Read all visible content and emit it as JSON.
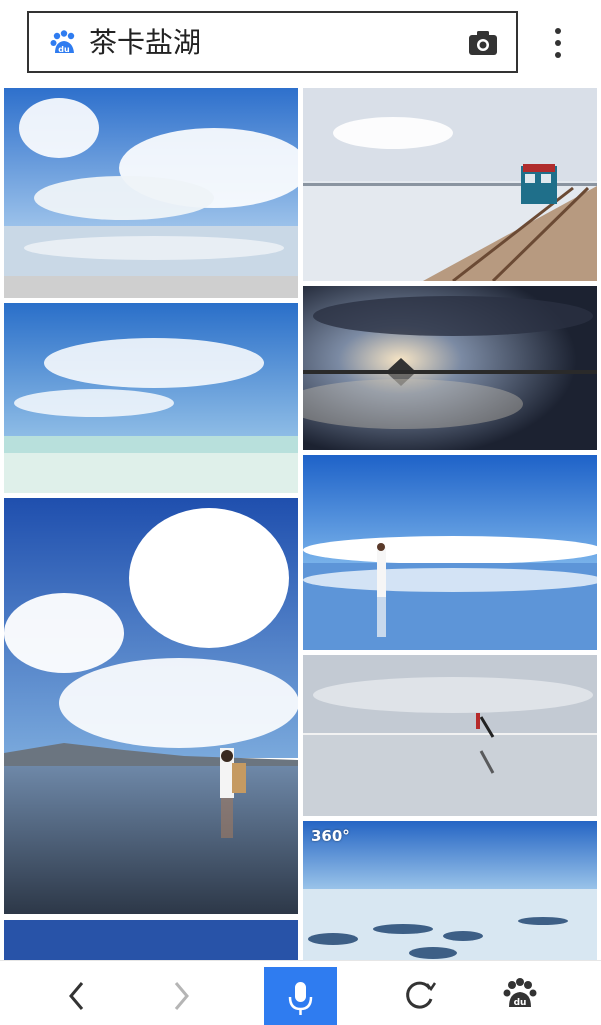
{
  "search": {
    "query": "茶卡盐湖",
    "logo_icon": "baidu-paw-icon",
    "camera_icon": "camera-icon",
    "menu_icon": "more-vertical-icon"
  },
  "results": {
    "tiles": [
      {
        "name": "result-image-1",
        "scene": "lake-clouds-reflection"
      },
      {
        "name": "result-image-2",
        "scene": "salt-lake-train"
      },
      {
        "name": "result-image-3",
        "scene": "sunset-reflection"
      },
      {
        "name": "result-image-4",
        "scene": "blue-sky-shore"
      },
      {
        "name": "result-image-5",
        "scene": "woman-white-dress"
      },
      {
        "name": "result-image-6",
        "scene": "woman-clouds-reflection"
      },
      {
        "name": "result-image-7",
        "scene": "jumping-person"
      },
      {
        "name": "result-image-8",
        "scene": "panorama-360"
      },
      {
        "name": "result-image-9",
        "scene": "partial-blue"
      }
    ],
    "badge_360": "360°"
  },
  "bottom_nav": {
    "back_icon": "back-arrow-icon",
    "forward_icon": "forward-arrow-icon",
    "voice_icon": "microphone-icon",
    "refresh_icon": "refresh-icon",
    "home_icon": "baidu-paw-icon"
  },
  "colors": {
    "accent": "#2f7cf0",
    "sky": "#2a6fc9",
    "border": "#333333"
  }
}
